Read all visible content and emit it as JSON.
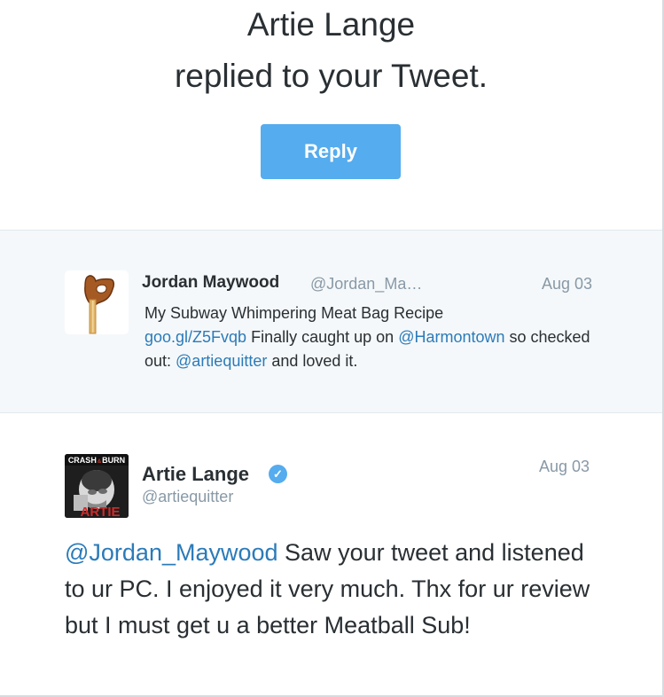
{
  "header": {
    "line1": "Artie Lange",
    "line2": "replied to your Tweet.",
    "reply_button": "Reply"
  },
  "original_tweet": {
    "author_name": "Jordan Maywood",
    "author_handle": "@Jordan_Ma…",
    "date": "Aug 03",
    "text_1": "My Subway Whimpering Meat Bag Recipe",
    "link_1": "goo.gl/Z5Fvqb",
    "text_2": " Finally caught up on ",
    "mention_1": "@Harmontown",
    "text_3": " so checked out: ",
    "mention_2": "@artiequitter",
    "text_4": " and loved it."
  },
  "reply_tweet": {
    "author_name": "Artie Lange",
    "verified": true,
    "author_handle": "@artiequitter",
    "date": "Aug 03",
    "mention": "@Jordan_Maywood",
    "text": " Saw your tweet and listened to ur PC. I enjoyed it very much. Thx for ur review but I must get u a better Meatball Sub!",
    "avatar_top_text": "CRASH",
    "avatar_top_text_2": "BURN",
    "avatar_bottom_text": "ARTIE"
  },
  "colors": {
    "accent": "#55acee",
    "link": "#2b7bb9",
    "muted": "#8899a6",
    "text": "#292f33",
    "panel": "#f5f8fa"
  }
}
